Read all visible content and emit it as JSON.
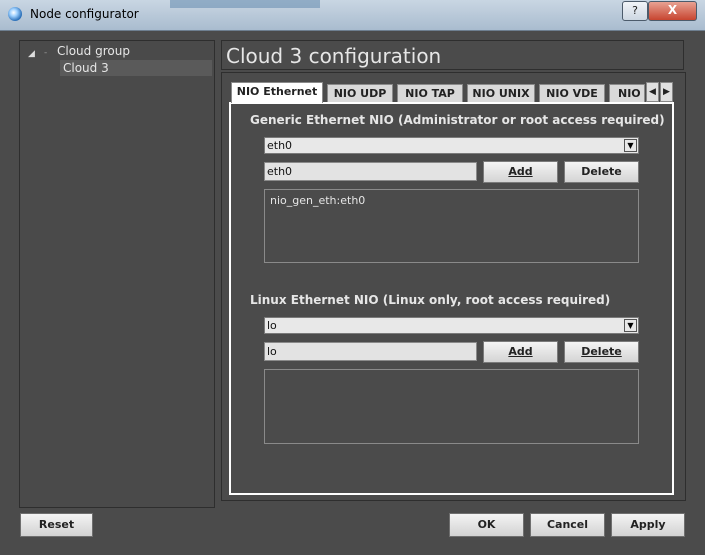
{
  "window": {
    "title": "Node configurator",
    "help_label": "?",
    "close_label": "X"
  },
  "tree": {
    "group_label": "Cloud group",
    "child_label": "Cloud 3"
  },
  "page_title": "Cloud 3 configuration",
  "tabs": [
    {
      "label": "NIO Ethernet",
      "active": true
    },
    {
      "label": "NIO UDP"
    },
    {
      "label": "NIO TAP"
    },
    {
      "label": "NIO UNIX"
    },
    {
      "label": "NIO VDE"
    },
    {
      "label": "NIO N"
    }
  ],
  "generic": {
    "heading": "Generic Ethernet NIO (Administrator or root access required)",
    "combo_value": "eth0",
    "input_value": "eth0",
    "add_label": "Add",
    "delete_label": "Delete",
    "list_items": [
      "nio_gen_eth:eth0"
    ]
  },
  "linux": {
    "heading": "Linux Ethernet NIO (Linux only, root access required)",
    "combo_value": "lo",
    "input_value": "lo",
    "add_label": "Add",
    "delete_label": "Delete",
    "list_items": []
  },
  "buttons": {
    "reset": "Reset",
    "ok": "OK",
    "cancel": "Cancel",
    "apply": "Apply"
  }
}
